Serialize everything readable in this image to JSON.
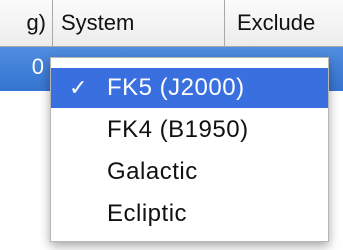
{
  "table": {
    "columns": [
      {
        "label": "g)"
      },
      {
        "label": "System"
      },
      {
        "label": "Exclude"
      }
    ],
    "selected_row": {
      "first_cell": "0"
    }
  },
  "popup_menu": {
    "check_mark": "✓",
    "selected_value": "FK5 (J2000)",
    "items": [
      {
        "label": "FK5 (J2000)",
        "checked": true,
        "highlighted": true
      },
      {
        "label": "FK4 (B1950)",
        "checked": false,
        "highlighted": false
      },
      {
        "label": "Galactic",
        "checked": false,
        "highlighted": false
      },
      {
        "label": "Ecliptic",
        "checked": false,
        "highlighted": false
      }
    ]
  },
  "colors": {
    "selection_row": "#3f80d8",
    "menu_highlight": "#3a6fe0",
    "header_border": "#a9a9a9"
  }
}
